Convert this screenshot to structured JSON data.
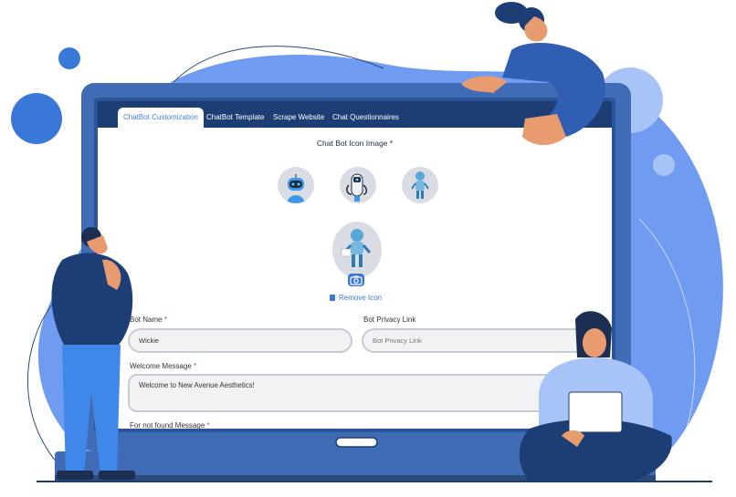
{
  "tabs": [
    {
      "label": "ChatBot Customization",
      "active": true
    },
    {
      "label": "ChatBot Template",
      "active": false
    },
    {
      "label": "Scrape Website",
      "active": false
    },
    {
      "label": "Chat Questionnaires",
      "active": false
    }
  ],
  "icon_section": {
    "title": "Chat Bot Icon Image *",
    "options": [
      "robot-head-icon",
      "robot-tool-icon",
      "robot-standing-icon"
    ],
    "selected_icon": "robot-standing-icon",
    "remove_label": "Remove Icon"
  },
  "form": {
    "bot_name_label": "Bot Name",
    "bot_name_value": "Wickie",
    "privacy_label": "Bot Privacy Link",
    "privacy_placeholder": "Bot Privacy Link",
    "welcome_label": "Welcome Message",
    "welcome_value": "Welcome to New Avenue Aesthetics!",
    "not_found_label": "For not found Message",
    "required_mark": "*"
  },
  "colors": {
    "tab_bar": "#1c3e74",
    "accent": "#3a78d8",
    "laptop_frame": "#3f6cb4",
    "blob": "#6f9cf1"
  }
}
